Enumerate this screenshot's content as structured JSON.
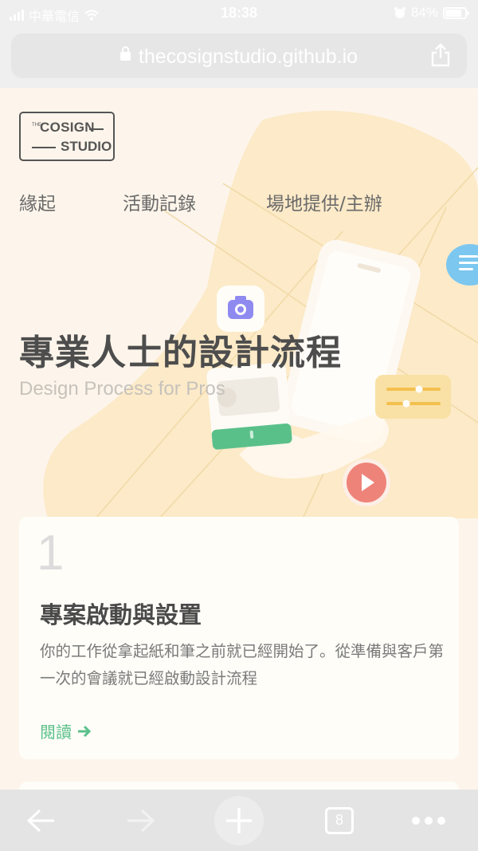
{
  "status_bar": {
    "carrier": "中華電信",
    "time": "18:38",
    "battery": "84%",
    "battery_level": 0.84
  },
  "browser": {
    "url": "thecosignstudio.github.io",
    "tab_count": "8"
  },
  "site": {
    "logo": {
      "the": "THE",
      "line1": "COSIGN",
      "line2": "STUDIO"
    },
    "nav": [
      {
        "label": "緣起"
      },
      {
        "label": "活動記錄"
      },
      {
        "label": "場地提供/主辦"
      }
    ],
    "hero": {
      "title": "專業人士的設計流程",
      "subtitle": "Design Process for Pros"
    },
    "card": {
      "number": "1",
      "title": "專案啟動與設置",
      "description": "你的工作從拿起紙和筆之前就已經開始了。從準備與客戶第一次的會議就已經啟動設計流程",
      "link": "閱讀"
    }
  },
  "colors": {
    "accent_green": "#5ac08a",
    "play_red": "#ee837a",
    "camera_purple": "#8f8af0",
    "slider_yellow": "#f3c04e",
    "bubble_blue": "#7cc7ef"
  }
}
